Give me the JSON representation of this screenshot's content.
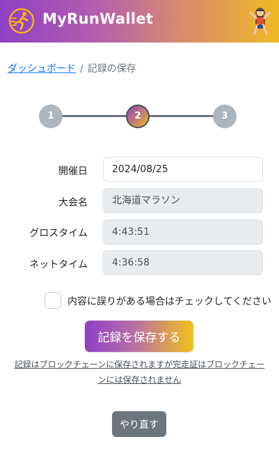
{
  "app": {
    "name": "MyRunWallet",
    "logo_icon": "runner-logo-icon",
    "profile_icon": "runner-avatar-icon"
  },
  "colors": {
    "brand_start": "#8f3fc4",
    "brand_end": "#f0b823",
    "link": "#0d6efd",
    "secondary": "#6c757d"
  },
  "breadcrumb": {
    "home": "ダッシュボード",
    "separator": "/",
    "current": "記録の保存"
  },
  "stepper": {
    "steps": [
      "1",
      "2",
      "3"
    ],
    "current": 2
  },
  "form": {
    "date_label": "開催日",
    "date_value": "2024/08/25",
    "event_label": "大会名",
    "event_value": "北海道マラソン",
    "gross_label": "グロスタイム",
    "gross_value": "4:43:51",
    "net_label": "ネットタイム",
    "net_value": "4:36:58"
  },
  "error_check": {
    "label": "内容に誤りがある場合はチェックしてください",
    "checked": false
  },
  "save_button": "記録を保存する",
  "note": "記録はブロックチェーンに保存されますが完走証はブロックチェーンには保存されません",
  "reset_button": "やり直す"
}
